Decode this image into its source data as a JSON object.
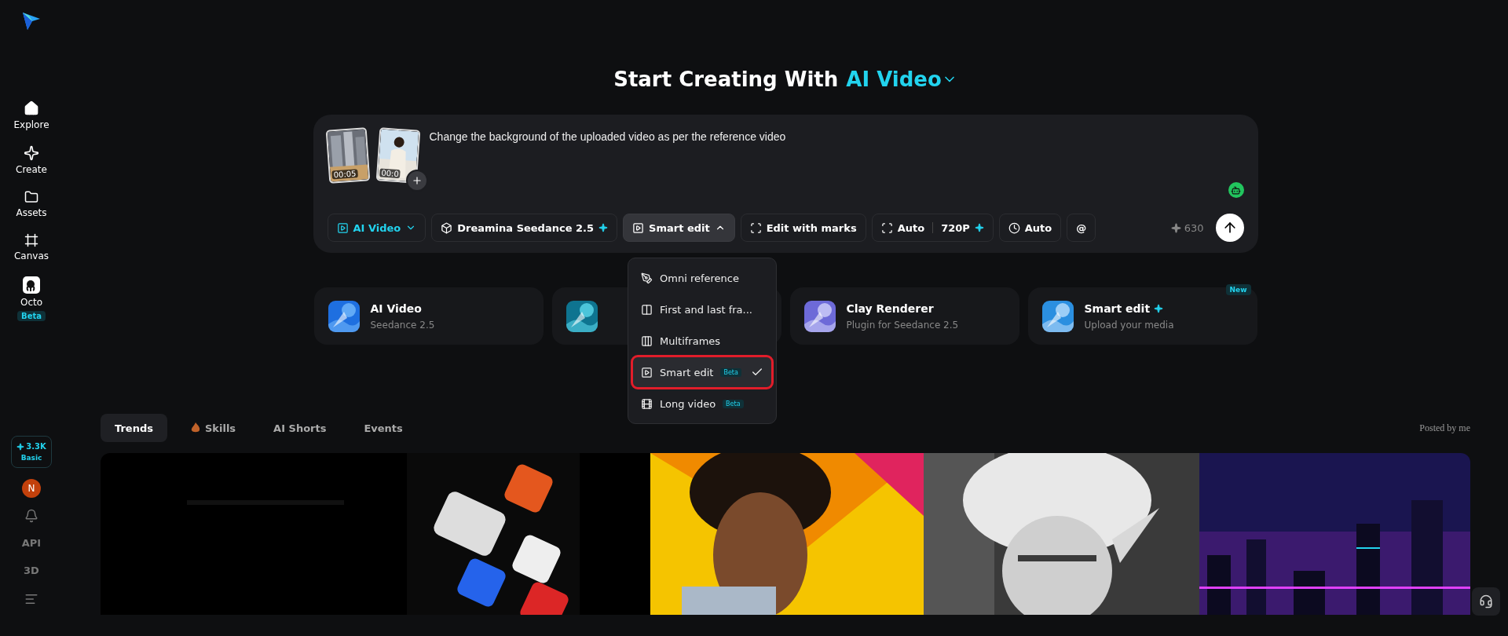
{
  "sidebar": {
    "nav": [
      {
        "kind": "home",
        "label": "Explore"
      },
      {
        "kind": "create",
        "label": "Create"
      },
      {
        "kind": "folder",
        "label": "Assets"
      },
      {
        "kind": "canvas",
        "label": "Canvas"
      },
      {
        "kind": "octo",
        "label": "Octo",
        "badge": "Beta"
      }
    ],
    "credits": {
      "amount": "3.3K",
      "plan": "Basic"
    },
    "avatar": "N",
    "bottom": [
      {
        "kind": "bell"
      },
      {
        "kind": "text",
        "label": "API"
      },
      {
        "kind": "text",
        "label": "3D"
      },
      {
        "kind": "menu"
      }
    ]
  },
  "heading": {
    "prefix": "Start Creating With",
    "mode": "AI Video"
  },
  "prompt": {
    "attachments": [
      {
        "duration": "00:05"
      },
      {
        "duration": "00:0"
      }
    ],
    "text": "Change the background of the uploaded video as per the reference video",
    "chips": [
      {
        "kind": "mode",
        "label": "AI Video"
      },
      {
        "kind": "model",
        "label": "Dreamina Seedance 2.5"
      },
      {
        "kind": "type",
        "label": "Smart edit",
        "expanded": true
      },
      {
        "kind": "marks",
        "label": "Edit with marks"
      },
      {
        "kind": "ratio",
        "label": "Auto",
        "extra": "720P"
      },
      {
        "kind": "duration",
        "label": "Auto"
      },
      {
        "kind": "at",
        "label": "@"
      }
    ],
    "credits": "630"
  },
  "dropdown": [
    {
      "kind": "omni",
      "label": "Omni reference",
      "selected": false
    },
    {
      "kind": "frames",
      "label": "First and last fra...",
      "selected": false
    },
    {
      "kind": "multi",
      "label": "Multiframes",
      "selected": false
    },
    {
      "kind": "smart",
      "label": "Smart edit",
      "badge": "Beta",
      "selected": true,
      "highlighted": true
    },
    {
      "kind": "long",
      "label": "Long video",
      "badge": "Beta",
      "selected": false
    }
  ],
  "cards": [
    {
      "kind": "feature",
      "title": "AI Video",
      "subtitle": "Seedance 2.5"
    },
    {
      "kind": "covered"
    },
    {
      "kind": "feature",
      "title": "Clay Renderer",
      "subtitle": "Plugin for Seedance 2.5"
    },
    {
      "kind": "feature",
      "title": "Smart edit",
      "subtitle": "Upload your media",
      "sparkle": true,
      "badge": "New"
    }
  ],
  "tabs": [
    {
      "label": "Trends",
      "selected": true
    },
    {
      "label": "Skills",
      "icon": true,
      "selected": false
    },
    {
      "label": "AI Shorts",
      "selected": false
    },
    {
      "label": "Events",
      "selected": false
    }
  ],
  "posted_by_me": "Posted by me"
}
